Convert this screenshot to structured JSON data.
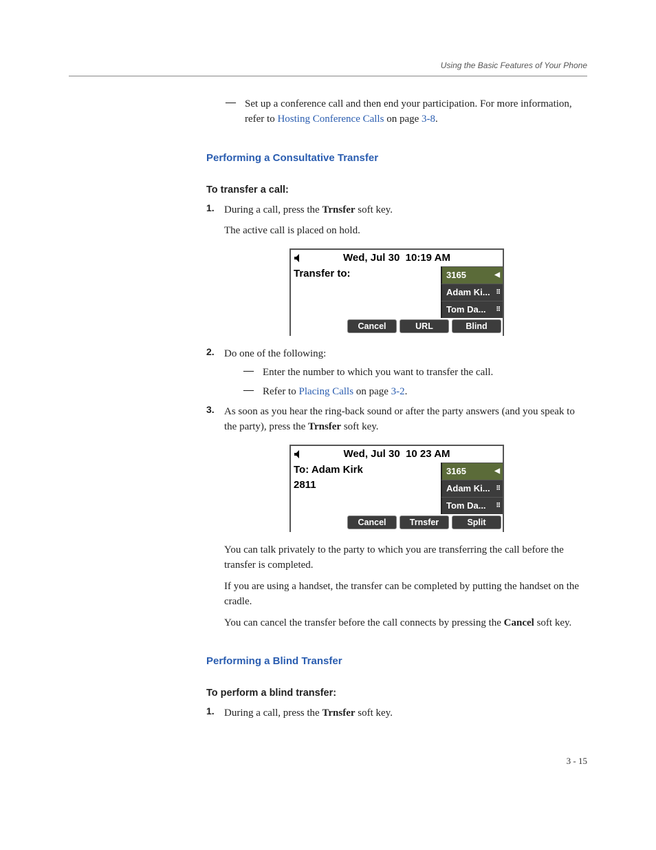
{
  "header": {
    "running_title": "Using the Basic Features of Your Phone"
  },
  "intro_dash": {
    "text_pre": "Set up a conference call and then end your participation. For more information, refer to ",
    "link_text": "Hosting Conference Calls",
    "text_mid": " on page ",
    "page_ref": "3-8",
    "text_post": "."
  },
  "heading_consult": "Performing a Consultative Transfer",
  "consult_sub": "To transfer a call:",
  "step1_pre": "During a call, press the ",
  "step1_bold": "Trnsfer",
  "step1_post": " soft key.",
  "step1_para": "The active call is placed on hold.",
  "screen1": {
    "date": "Wed, Jul 30",
    "time": "10:19 AM",
    "main_line": "Transfer to:",
    "main_line2": "",
    "side1": "3165",
    "side2": "Adam Ki...",
    "side3": "Tom Da...",
    "sk1": "Cancel",
    "sk2": "URL",
    "sk3": "Blind"
  },
  "step2_text": "Do one of the following:",
  "step2_dash1": "Enter the number to which you want to transfer the call.",
  "step2_dash2_pre": "Refer to ",
  "step2_dash2_link": "Placing Calls",
  "step2_dash2_mid": " on page ",
  "step2_dash2_page": "3-2",
  "step2_dash2_post": ".",
  "step3_pre": "As soon as you hear the ring-back sound or after the party answers (and you speak to the party), press the ",
  "step3_bold": "Trnsfer",
  "step3_post": " soft key.",
  "screen2": {
    "date": "Wed, Jul 30",
    "time": "10 23 AM",
    "main_line": "To: Adam Kirk",
    "main_line2": "2811",
    "side1": "3165",
    "side2": "Adam Ki...",
    "side3": "Tom Da...",
    "sk1": "Cancel",
    "sk2": "Trnsfer",
    "sk3": "Split"
  },
  "para_after1": "You can talk privately to the party to which you are transferring the call before the transfer is completed.",
  "para_after2": "If you are using a handset, the transfer can be completed by putting the handset on the cradle.",
  "para_after3_pre": "You can cancel the transfer before the call connects by pressing the ",
  "para_after3_bold": "Cancel",
  "para_after3_post": " soft key.",
  "heading_blind": "Performing a Blind Transfer",
  "blind_sub": "To perform a blind transfer:",
  "blind_step1_pre": "During a call, press the ",
  "blind_step1_bold": "Trnsfer",
  "blind_step1_post": " soft key.",
  "footer": {
    "page": "3 - 15"
  },
  "labels": {
    "n1": "1.",
    "n2": "2.",
    "n3": "3."
  }
}
